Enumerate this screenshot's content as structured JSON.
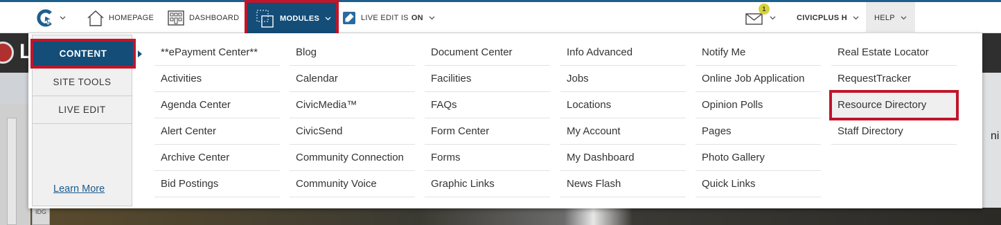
{
  "topbar": {
    "home_label": "HOMEPAGE",
    "dashboard_label": "DASHBOARD",
    "modules_label": "MODULES",
    "live_edit_label": "LIVE EDIT IS",
    "live_edit_state": "ON",
    "mail_badge": "1",
    "user_label": "CIVICPLUS H",
    "help_label": "HELP"
  },
  "sidebar": {
    "items": [
      {
        "label": "CONTENT"
      },
      {
        "label": "SITE TOOLS"
      },
      {
        "label": "LIVE EDIT"
      }
    ],
    "learn_more": "Learn More"
  },
  "columns": [
    [
      "**ePayment Center**",
      "Activities",
      "Agenda Center",
      "Alert Center",
      "Archive Center",
      "Bid Postings"
    ],
    [
      "Blog",
      "Calendar",
      "CivicMedia™",
      "CivicSend",
      "Community Connection",
      "Community Voice"
    ],
    [
      "Document Center",
      "Facilities",
      "FAQs",
      "Form Center",
      "Forms",
      "Graphic Links"
    ],
    [
      "Info Advanced",
      "Jobs",
      "Locations",
      "My Account",
      "My Dashboard",
      "News Flash"
    ],
    [
      "Notify Me",
      "Online Job Application",
      "Opinion Polls",
      "Pages",
      "Photo Gallery",
      "Quick Links"
    ],
    [
      "Real Estate Locator",
      "RequestTracker",
      "Resource Directory",
      "Staff Directory"
    ]
  ],
  "background": {
    "logo_letter": "L",
    "right_text": "ni",
    "scroll_tab": "IDG"
  },
  "colors": {
    "accent": "#134d78",
    "highlight_border": "#c0152a",
    "badge": "#d6d33a"
  }
}
